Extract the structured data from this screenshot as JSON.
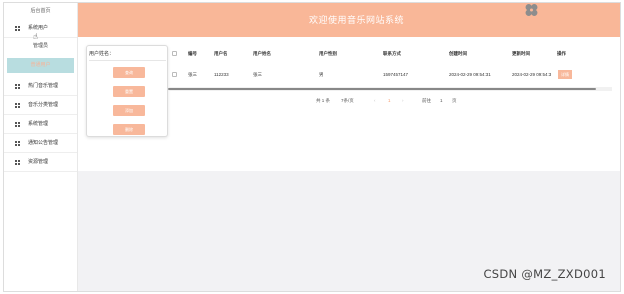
{
  "header": {
    "title": "欢迎使用音乐网站系统"
  },
  "sidebar": {
    "home": "后台首页",
    "items": [
      {
        "label": "系统用户",
        "icon": "user-grid-icon"
      },
      {
        "label": "热门音乐管理",
        "icon": "grid-icon"
      },
      {
        "label": "音乐分类管理",
        "icon": "grid-icon"
      },
      {
        "label": "系统管理",
        "icon": "grid-icon"
      },
      {
        "label": "通知公告管理",
        "icon": "grid-icon"
      },
      {
        "label": "资源管理",
        "icon": "grid-icon"
      }
    ],
    "sub_items": {
      "admin": "管理员",
      "active": "普通用户"
    }
  },
  "search": {
    "label": "用户姓名：",
    "buttons": {
      "query": "查询",
      "reset": "重置",
      "add": "添加",
      "delete": "删除"
    }
  },
  "table": {
    "headers": [
      "编号",
      "用户名",
      "用户姓名",
      "用户性别",
      "联系方式",
      "创建时间",
      "更新时间",
      "操作"
    ],
    "rows": [
      {
        "id": "张三",
        "username": "112233",
        "name": "张三",
        "gender": "男",
        "phone": "1597457147",
        "created": "2024-02-29 09:54:31",
        "updated": "2024-02-29 09:54:3",
        "action": "详情"
      }
    ]
  },
  "pagination": {
    "total": "共 1 条",
    "page_size": "7条/页",
    "prev": "‹",
    "current": "1",
    "next": "›",
    "goto_label": "前往",
    "goto_value": "1",
    "page_unit": "页"
  },
  "watermark": "CSDN @MZ_ZXD001",
  "colors": {
    "accent": "#f9b798",
    "active_bg": "#b8dde0",
    "grey_bg": "#f2f2f4"
  }
}
